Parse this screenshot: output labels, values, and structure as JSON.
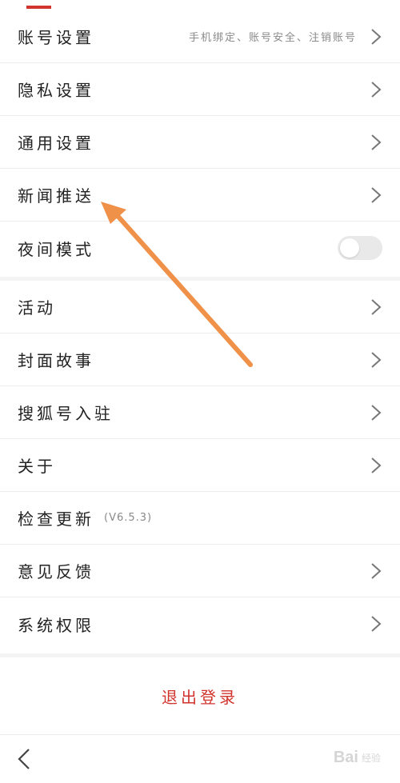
{
  "settings_group1": [
    {
      "label": "账号设置",
      "hint": "手机绑定、账号安全、注销账号",
      "control": "chevron"
    },
    {
      "label": "隐私设置",
      "control": "chevron"
    },
    {
      "label": "通用设置",
      "control": "chevron"
    },
    {
      "label": "新闻推送",
      "control": "chevron"
    },
    {
      "label": "夜间模式",
      "control": "toggle",
      "toggle_on": false
    }
  ],
  "settings_group2": [
    {
      "label": "活动",
      "control": "chevron"
    },
    {
      "label": "封面故事",
      "control": "chevron"
    },
    {
      "label": "搜狐号入驻",
      "control": "chevron"
    },
    {
      "label": "关于",
      "control": "chevron"
    },
    {
      "label": "检查更新",
      "version": "(V6.5.3)",
      "control": "none"
    },
    {
      "label": "意见反馈",
      "control": "chevron"
    },
    {
      "label": "系统权限",
      "control": "chevron"
    }
  ],
  "logout_label": "退出登录",
  "watermark": {
    "text": "Bai",
    "sub": "经验"
  },
  "colors": {
    "accent": "#d0342c",
    "annotation_arrow": "#f0914a",
    "divider": "#ececec",
    "section_gap": "#f4f4f4"
  },
  "icons": {
    "chevron": "chevron-right-icon",
    "back": "back-arrow-icon"
  }
}
